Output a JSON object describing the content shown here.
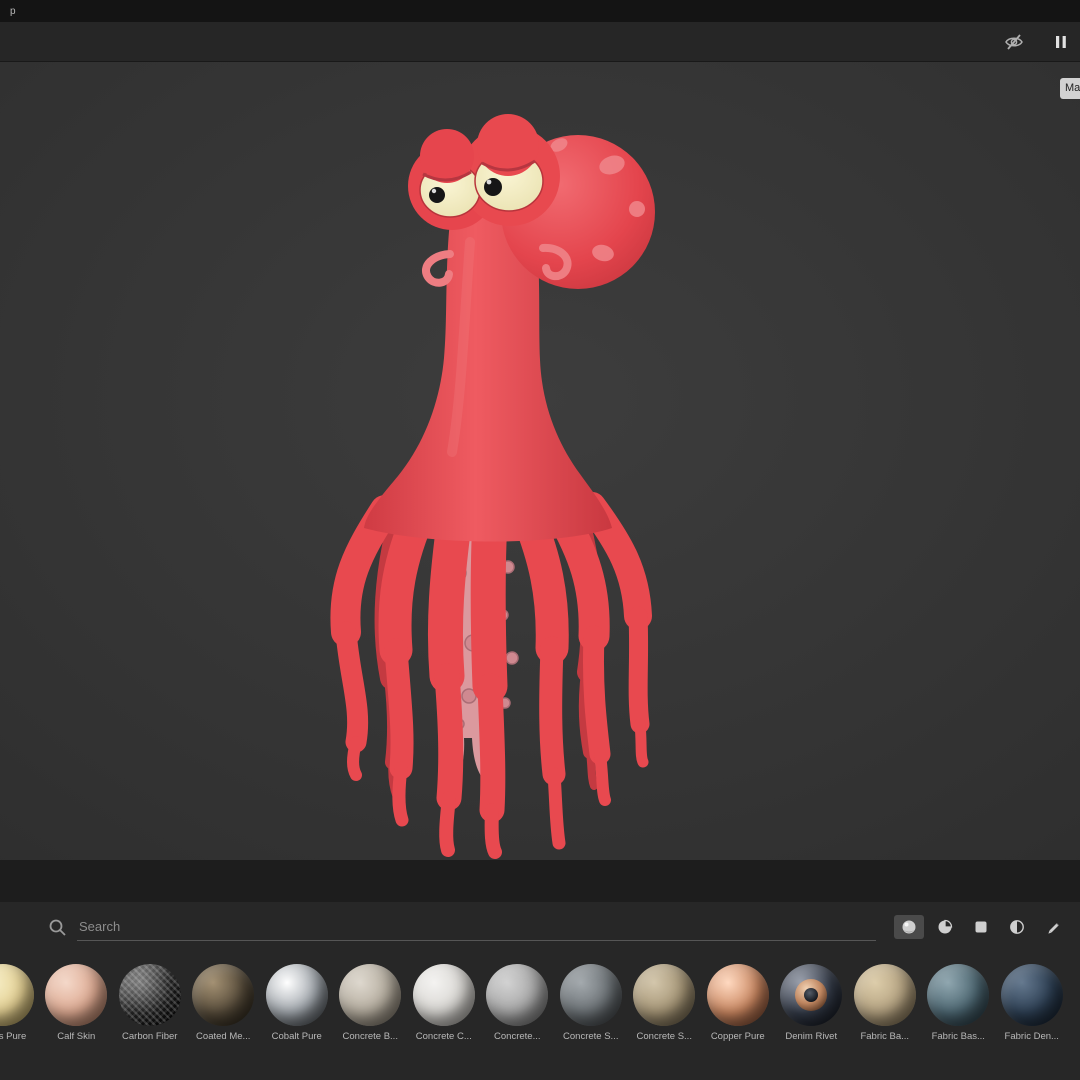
{
  "titlebar": {
    "title_fragment": "p"
  },
  "toolbar": {
    "icons": [
      "visibility-off",
      "pause"
    ]
  },
  "viewport": {
    "panel_handle_label": "Ma"
  },
  "icons": {
    "visibility_off": "eye-with-slash",
    "pause": "pause-bars",
    "search": "magnifier",
    "materials_filter": "sphere",
    "smart_materials_filter": "three-quarter-disc",
    "textures_filter": "square",
    "filters_filter": "half-disc",
    "brushes_filter": "pencil"
  },
  "colors": {
    "accent_red": "#e8494f",
    "panel_bg": "#272727",
    "viewport_bg": "#383838"
  },
  "assets_panel": {
    "search": {
      "placeholder": "Search"
    },
    "active_filter": "materials",
    "filters": [
      "materials",
      "smart-materials",
      "textures",
      "filters",
      "brushes"
    ],
    "materials": [
      {
        "name": "Brass Pure",
        "colors": [
          "#f7efc8",
          "#e3cf92",
          "#8f7c42"
        ]
      },
      {
        "name": "Calf Skin",
        "colors": [
          "#f4d8c9",
          "#dca890",
          "#95664f"
        ]
      },
      {
        "name": "Carbon Fiber",
        "colors": [
          "#7a7a7a",
          "#232323",
          "#000000"
        ],
        "variant": "weave"
      },
      {
        "name": "Coated Me...",
        "colors": [
          "#a39072",
          "#564b3a",
          "#241f15"
        ]
      },
      {
        "name": "Cobalt Pure",
        "colors": [
          "#ffffff",
          "#9fa5ab",
          "#34383c"
        ]
      },
      {
        "name": "Concrete B...",
        "colors": [
          "#ded8ce",
          "#b2aa9c",
          "#6f675b"
        ]
      },
      {
        "name": "Concrete C...",
        "colors": [
          "#f4f3f1",
          "#d7d5d1",
          "#96938e"
        ]
      },
      {
        "name": "Concrete...",
        "colors": [
          "#d2d2d2",
          "#a6a6a6",
          "#646464"
        ]
      },
      {
        "name": "Concrete S...",
        "colors": [
          "#a3a9ad",
          "#6b7175",
          "#35383b"
        ]
      },
      {
        "name": "Concrete S...",
        "colors": [
          "#d3c6ab",
          "#a49475",
          "#5f5440"
        ]
      },
      {
        "name": "Copper Pure",
        "colors": [
          "#ffd9c0",
          "#c8855f",
          "#6b3a26"
        ]
      },
      {
        "name": "Denim Rivet",
        "colors": [
          "#9aa0ad",
          "#333a47",
          "#0e1118"
        ],
        "variant": "rivet"
      },
      {
        "name": "Fabric Ba...",
        "colors": [
          "#ddcdaa",
          "#b3a180",
          "#6e5f45"
        ]
      },
      {
        "name": "Fabric Bas...",
        "colors": [
          "#8fa6af",
          "#4c6671",
          "#203038"
        ]
      },
      {
        "name": "Fabric Den...",
        "colors": [
          "#64788e",
          "#2d3f53",
          "#111a25"
        ]
      }
    ]
  }
}
